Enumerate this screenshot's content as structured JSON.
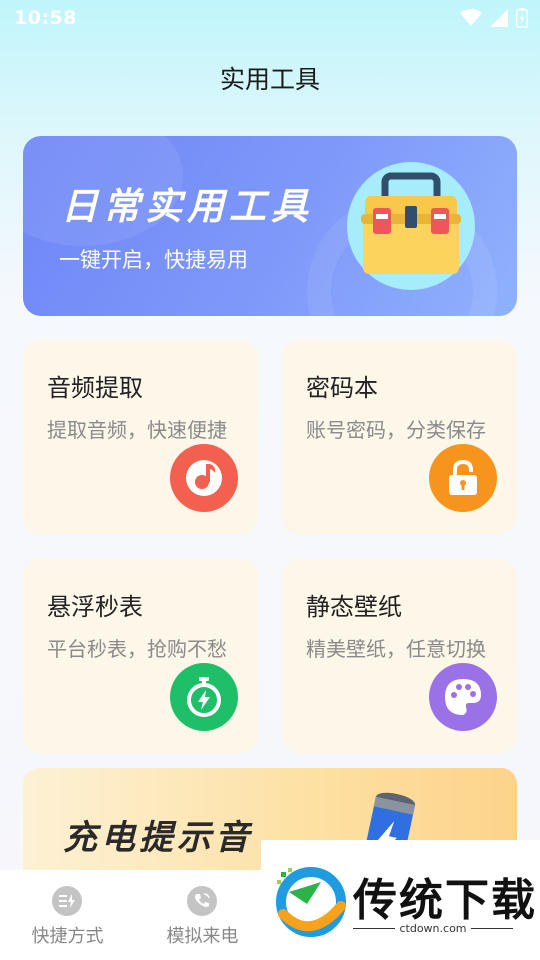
{
  "status": {
    "time": "10:58"
  },
  "page_title": "实用工具",
  "banner": {
    "title": "日常实用工具",
    "subtitle": "一键开启，快捷易用"
  },
  "cards": [
    {
      "title": "音频提取",
      "subtitle": "提取音频，快速便捷",
      "icon": "music-note-icon",
      "color": "#f4604f"
    },
    {
      "title": "密码本",
      "subtitle": "账号密码，分类保存",
      "icon": "padlock-icon",
      "color": "#f7941d"
    },
    {
      "title": "悬浮秒表",
      "subtitle": "平台秒表，抢购不愁",
      "icon": "stopwatch-icon",
      "color": "#1fbf6a"
    },
    {
      "title": "静态壁纸",
      "subtitle": "精美壁纸，任意切换",
      "icon": "palette-icon",
      "color": "#9b71e8"
    }
  ],
  "promo": {
    "title": "充电提示音",
    "icon": "battery-icon"
  },
  "tabbar": {
    "items": [
      {
        "label": "快捷方式",
        "icon": "shortcut-icon"
      },
      {
        "label": "模拟来电",
        "icon": "phone-call-icon"
      }
    ]
  },
  "watermark": {
    "name": "传统下载",
    "url": "ctdown.com"
  }
}
